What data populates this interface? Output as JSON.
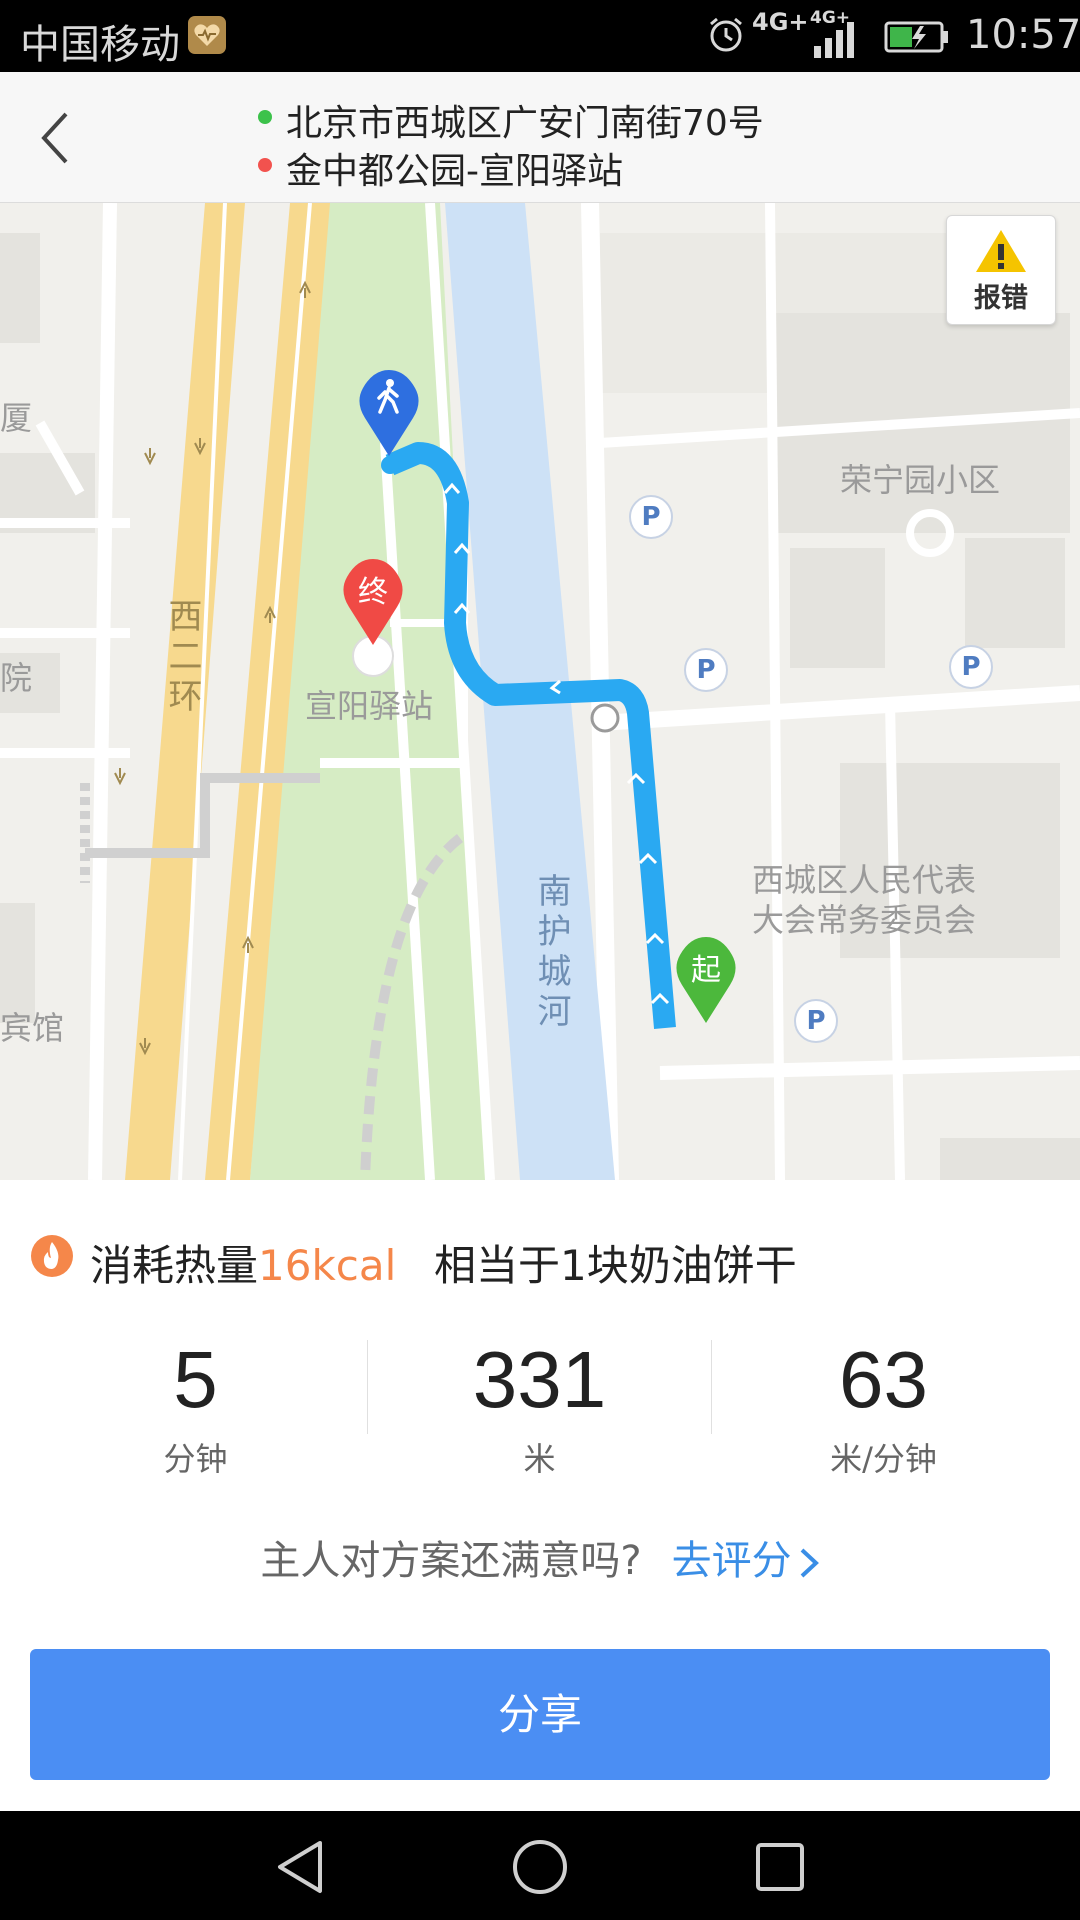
{
  "status_bar": {
    "carrier": "中国移动",
    "network": "4G+",
    "network_secondary": "4G+",
    "time": "10:57"
  },
  "header": {
    "origin": "北京市西城区广安门南街70号",
    "destination": "金中都公园-宣阳驿站",
    "origin_dot_color": "#3cc24b",
    "destination_dot_color": "#f2524e"
  },
  "map": {
    "report_label": "报错",
    "pins": {
      "walker_icon": "walker-icon",
      "end_label": "终",
      "start_label": "起"
    },
    "labels": {
      "station": "宣阳驿站",
      "road": "西二环",
      "river": "南护城河",
      "community": "荣宁园小区",
      "committee_line1": "西城区人民代表",
      "committee_line2": "大会常务委员会",
      "left_fragment1": "厦",
      "left_fragment2": "院",
      "left_fragment3": "宾馆",
      "parking": "P"
    },
    "route_color": "#2aa9f2"
  },
  "calories": {
    "prefix": "消耗热量",
    "value": "16kcal",
    "equivalent": "相当于1块奶油饼干"
  },
  "stats": [
    {
      "value": "5",
      "unit": "分钟"
    },
    {
      "value": "331",
      "unit": "米"
    },
    {
      "value": "63",
      "unit": "米/分钟"
    }
  ],
  "rating": {
    "question": "主人对方案还满意吗?",
    "link": "去评分"
  },
  "share_label": "分享",
  "colors": {
    "accent": "#4b8ef3",
    "calorie": "#f5874a",
    "link": "#3a8ee6"
  }
}
